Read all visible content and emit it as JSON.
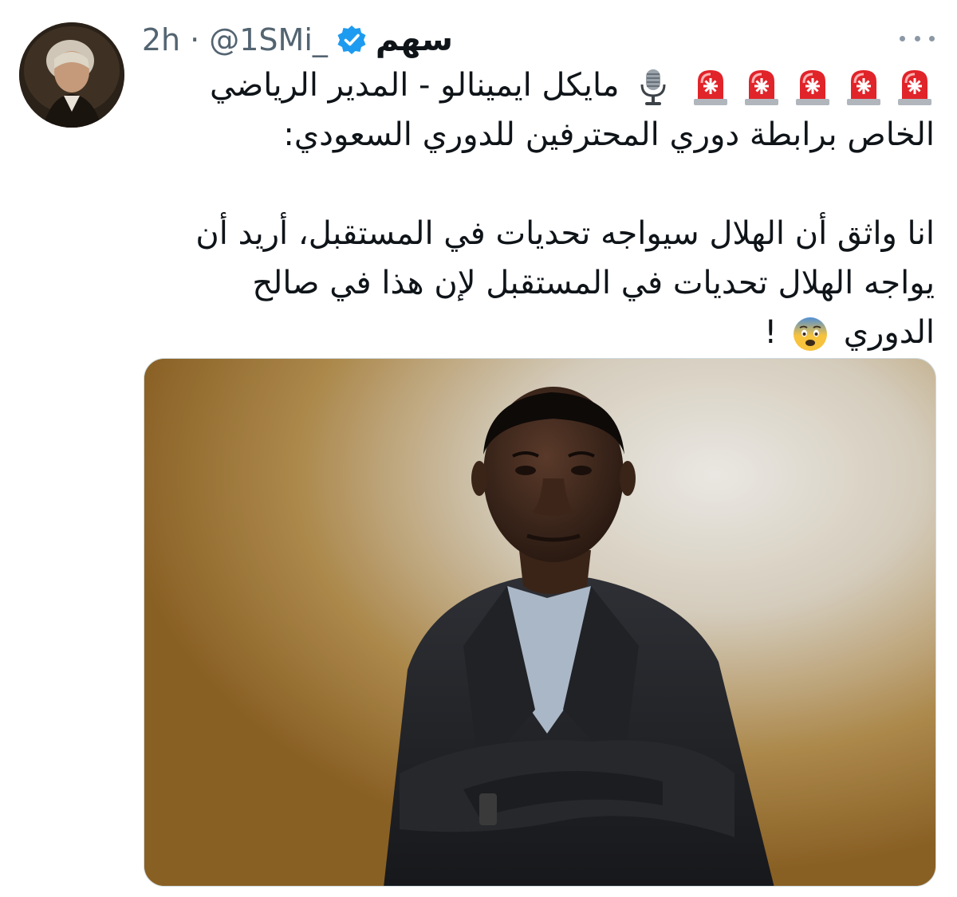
{
  "tweet": {
    "display_name": "سهم",
    "handle": "@1SMi_",
    "separator": "·",
    "time": "2h",
    "verified_icon": "verified-badge-icon",
    "more_icon": "more-options-icon",
    "text": {
      "line1": "مايكل ايمينالو - المدير الرياضي",
      "line2": "الخاص برابطة دوري المحترفين للدوري السعودي:",
      "line3": "انا واثق أن الهلال سيواجه تحديات في المستقبل، أريد أن",
      "line4": "يواجه الهلال تحديات في المستقبل لإن هذا في صالح",
      "line5_word": "الدوري",
      "line5_end": "!"
    },
    "emojis": {
      "siren": "police-car-light-emoji",
      "siren_count": 5,
      "microphone": "studio-microphone-emoji",
      "face": "fearful-face-emoji"
    },
    "colors": {
      "verified": "#1d9bf0",
      "text": "#0f1419",
      "secondary": "#536471"
    }
  }
}
